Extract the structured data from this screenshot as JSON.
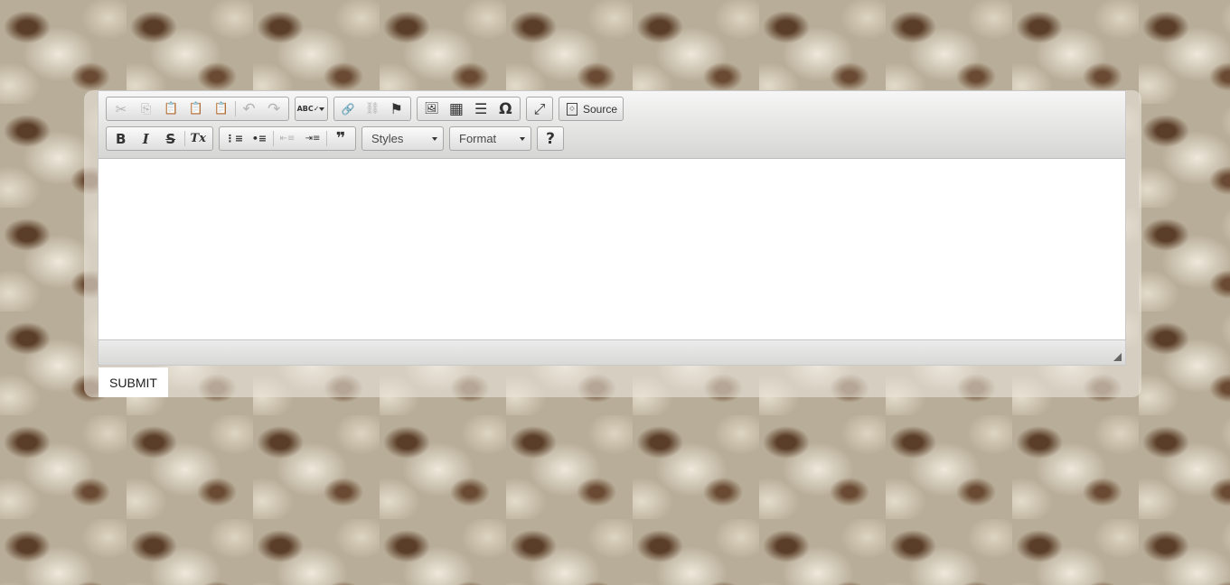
{
  "toolbar": {
    "row1": {
      "clipboard": [
        {
          "name": "cut-icon",
          "glyph": "✂",
          "enabled": false
        },
        {
          "name": "copy-icon",
          "glyph": "⎘",
          "enabled": false
        },
        {
          "name": "paste-icon",
          "glyph": "📋",
          "enabled": true
        },
        {
          "name": "paste-text-icon",
          "glyph": "📋",
          "enabled": true
        },
        {
          "name": "paste-from-word-icon",
          "glyph": "📋",
          "enabled": true
        }
      ],
      "undo": [
        {
          "name": "undo-icon",
          "glyph": "↶",
          "enabled": false
        },
        {
          "name": "redo-icon",
          "glyph": "↷",
          "enabled": false
        }
      ],
      "spellcheck": {
        "name": "spellcheck-icon",
        "glyph": "ABC✓"
      },
      "links": [
        {
          "name": "link-icon",
          "glyph": "🔗",
          "enabled": true
        },
        {
          "name": "unlink-icon",
          "glyph": "⛓",
          "enabled": false
        },
        {
          "name": "anchor-flag-icon",
          "glyph": "⚑",
          "enabled": true
        }
      ],
      "insert": [
        {
          "name": "image-icon",
          "glyph": "🖼"
        },
        {
          "name": "table-icon",
          "glyph": "▦"
        },
        {
          "name": "horizontal-line-icon",
          "glyph": "☰"
        },
        {
          "name": "special-char-icon",
          "glyph": "Ω"
        }
      ],
      "maximize": {
        "name": "maximize-icon",
        "glyph": "⤢"
      },
      "source_label": "Source"
    },
    "row2": {
      "basic": [
        {
          "name": "bold-icon",
          "glyph": "B"
        },
        {
          "name": "italic-icon",
          "glyph": "I"
        },
        {
          "name": "strike-icon",
          "glyph": "S"
        },
        {
          "name": "remove-format-icon",
          "glyph": "Tx"
        }
      ],
      "lists": [
        {
          "name": "numbered-list-icon",
          "glyph": "⋮≡",
          "enabled": true
        },
        {
          "name": "bulleted-list-icon",
          "glyph": "•≡",
          "enabled": true
        },
        {
          "name": "outdent-icon",
          "glyph": "⇤≡",
          "enabled": false
        },
        {
          "name": "indent-icon",
          "glyph": "⇥≡",
          "enabled": true
        },
        {
          "name": "blockquote-icon",
          "glyph": "❞",
          "enabled": true
        }
      ],
      "styles_label": "Styles",
      "format_label": "Format",
      "help_glyph": "?"
    }
  },
  "submit_label": "SUBMIT"
}
